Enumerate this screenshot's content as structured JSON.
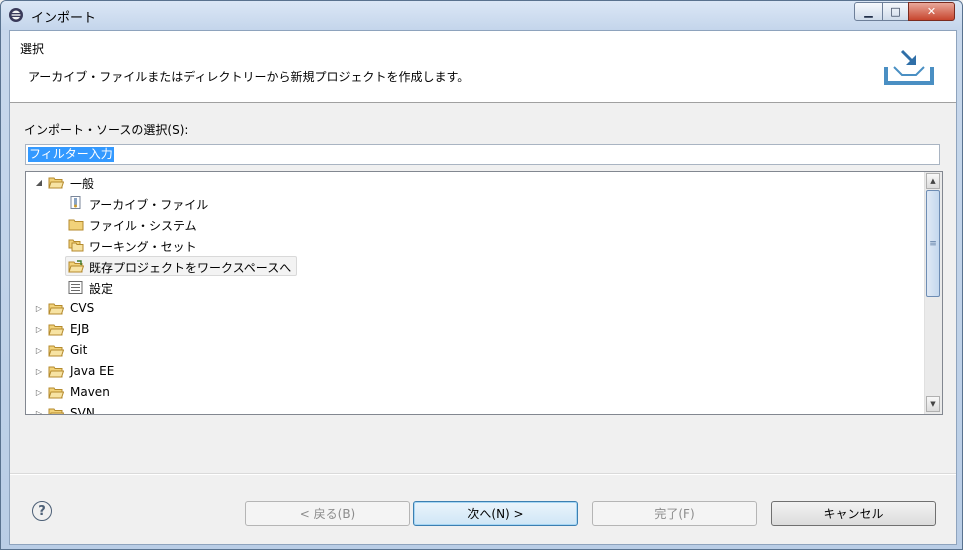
{
  "window": {
    "title": "インポート"
  },
  "banner": {
    "title": "選択",
    "description": "アーカイブ・ファイルまたはディレクトリーから新規プロジェクトを作成します。"
  },
  "source": {
    "label": "インポート・ソースの選択(S):",
    "filter_value": "フィルター入力"
  },
  "tree": {
    "items": [
      {
        "label": "一般",
        "expanded": true,
        "icon": "folder-open-icon"
      },
      {
        "label": "アーカイブ・ファイル",
        "icon": "archive-file-icon"
      },
      {
        "label": "ファイル・システム",
        "icon": "folder-icon"
      },
      {
        "label": "ワーキング・セット",
        "icon": "working-set-icon"
      },
      {
        "label": "既存プロジェクトをワークスペースへ",
        "icon": "existing-project-icon",
        "selected": true
      },
      {
        "label": "設定",
        "icon": "preferences-icon"
      },
      {
        "label": "CVS",
        "icon": "folder-icon"
      },
      {
        "label": "EJB",
        "icon": "folder-icon"
      },
      {
        "label": "Git",
        "icon": "folder-icon"
      },
      {
        "label": "Java EE",
        "icon": "folder-icon"
      },
      {
        "label": "Maven",
        "icon": "folder-icon"
      },
      {
        "label": "SVN",
        "icon": "folder-icon"
      }
    ]
  },
  "buttons": {
    "help": "?",
    "back": "< 戻る(B)",
    "next": "次へ(N) >",
    "finish": "完了(F)",
    "cancel": "キャンセル"
  },
  "colors": {
    "selection": "#3399ff",
    "folder": "#e8c15a"
  }
}
